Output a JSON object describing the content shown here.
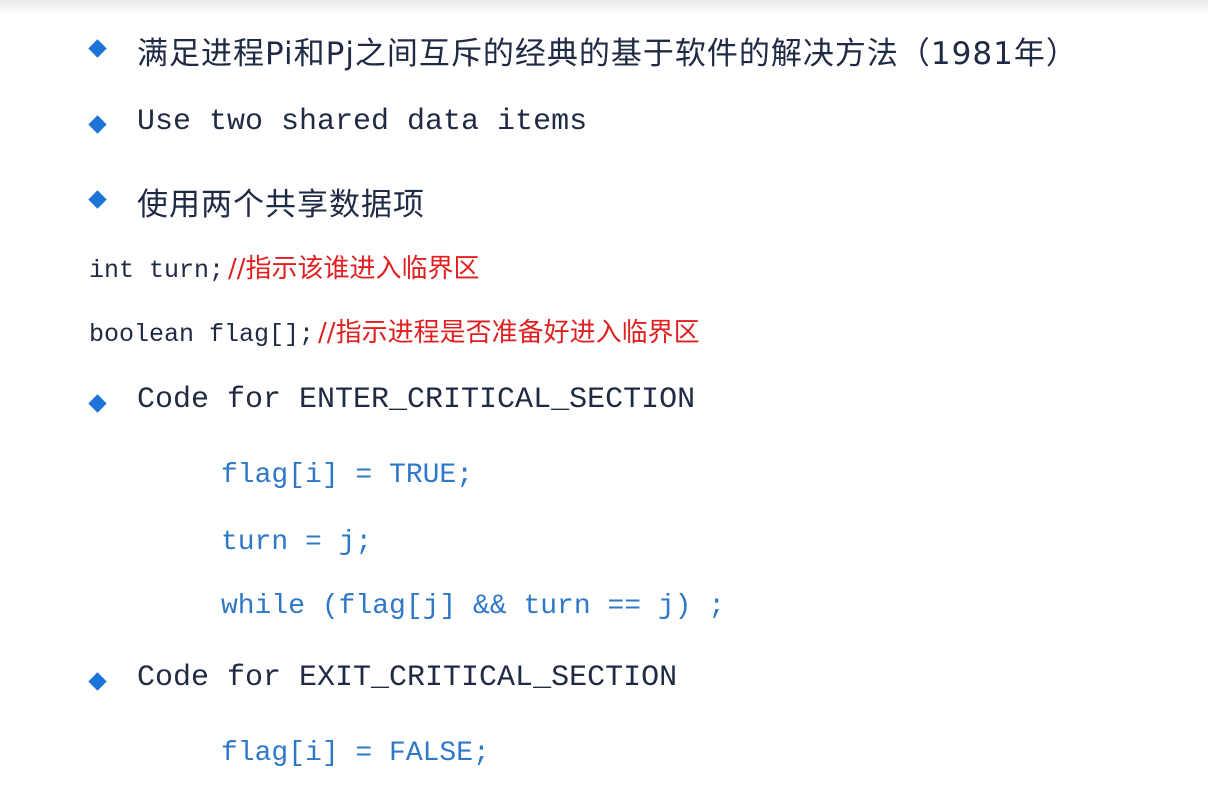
{
  "bullets": {
    "b1": "满足进程Pi和Pj之间互斥的经典的基于软件的解决方法（1981年）",
    "b2": "Use two shared data items",
    "b3": "使用两个共享数据项",
    "b4": "Code for ENTER_CRITICAL_SECTION",
    "b5": "Code for EXIT_CRITICAL_SECTION"
  },
  "declarations": {
    "turn_code": "int turn;",
    "turn_comment": "//指示该谁进入临界区",
    "flag_code": "boolean flag[];",
    "flag_comment": "//指示进程是否准备好进入临界区"
  },
  "enter_code": {
    "line1": "flag[i] = TRUE;",
    "line2": "turn = j;",
    "line3": "while (flag[j] && turn == j) ;"
  },
  "exit_code": {
    "line1": "flag[i] = FALSE;"
  },
  "colors": {
    "bullet": "#1d74d8",
    "comment": "#e02020",
    "code": "#2f78c8",
    "text": "#1f2a44"
  },
  "icons": {
    "bullet": "blue-diamond-icon"
  }
}
